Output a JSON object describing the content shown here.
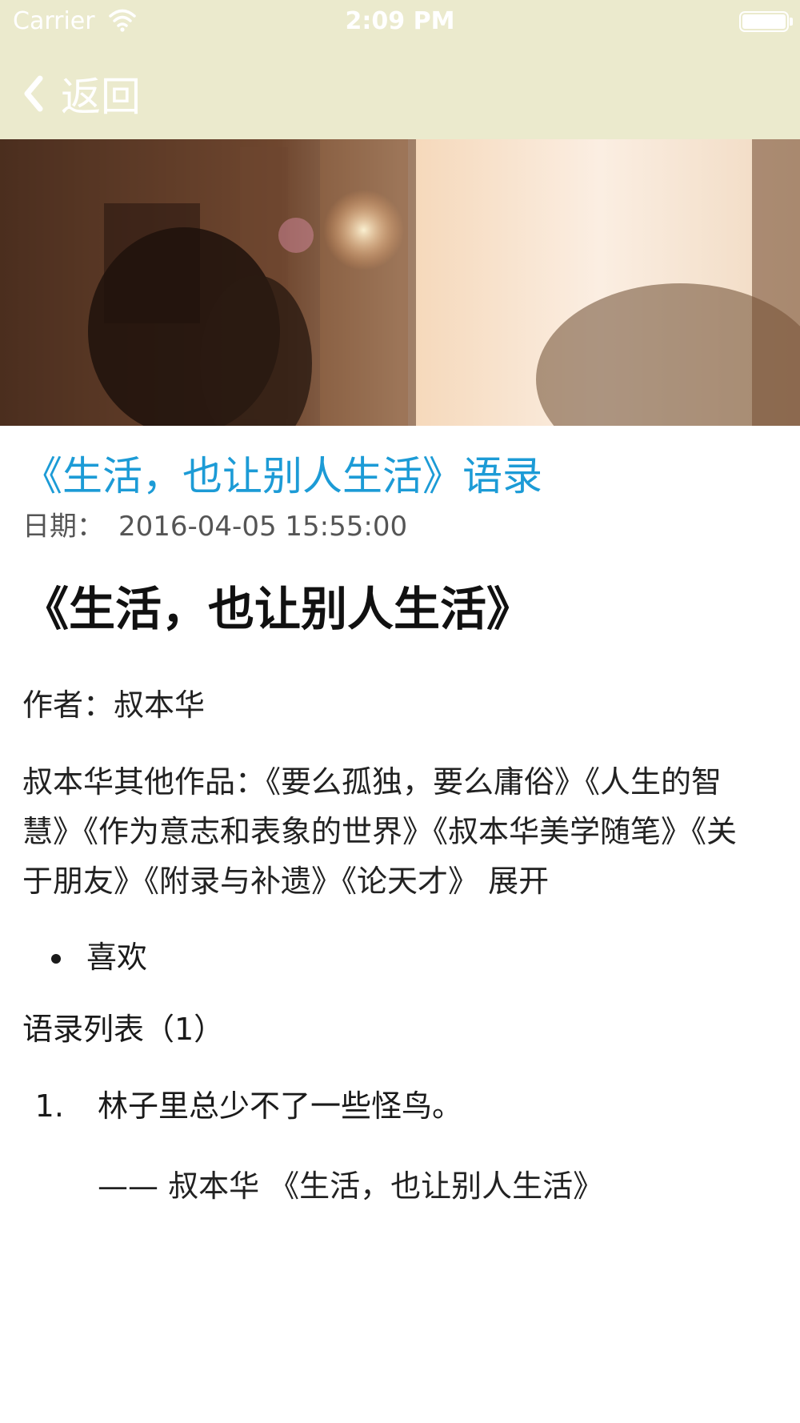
{
  "status_bar": {
    "carrier": "Carrier",
    "time": "2:09 PM",
    "battery_level": 1.0
  },
  "nav": {
    "back_label": "返回",
    "icon": "chevron-left-icon",
    "bar_color": "#ebeacd"
  },
  "article": {
    "title": "《生活，也让别人生活》语录",
    "title_color": "#1c9bd6",
    "date_label": "日期：",
    "date_value": "2016-04-05 15:55:00",
    "heading": "《生活，也让别人生活》",
    "author_line": "作者：叔本华",
    "other_works_text": "叔本华其他作品：《要么孤独，要么庸俗》《人生的智慧》《作为意志和表象的世界》《叔本华美学随笔》《关于朋友》《附录与补遗》《论天才》",
    "expand_label": "展开",
    "like_label": "喜欢",
    "quote_list_heading": "语录列表（1）",
    "quotes": [
      {
        "text": "林子里总少不了一些怪鸟。",
        "source": "—— 叔本华 《生活，也让别人生活》"
      }
    ]
  }
}
